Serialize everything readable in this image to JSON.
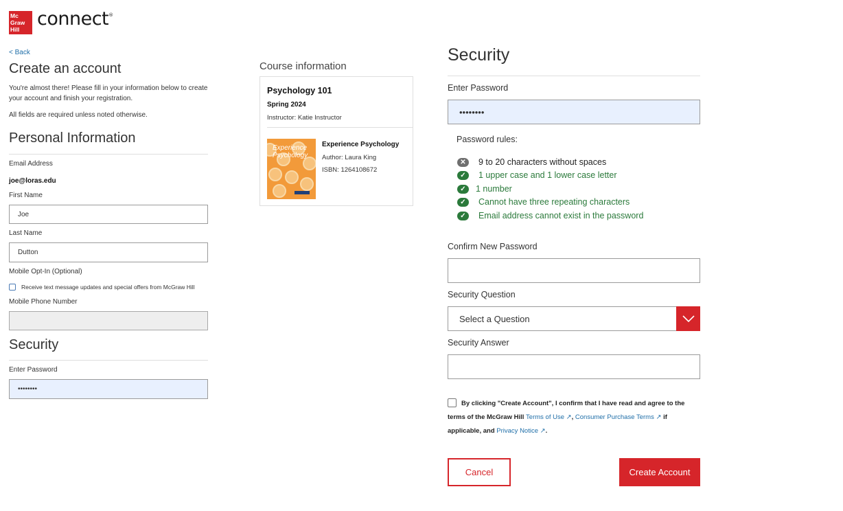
{
  "brand": {
    "logo_lines": [
      "Mc",
      "Graw",
      "Hill"
    ],
    "product": "connect",
    "accent": "#d6252a"
  },
  "nav": {
    "back": "< Back"
  },
  "page": {
    "title": "Create an account",
    "intro": "You're almost there! Please fill in your information below to create your account and finish your registration.",
    "required_note": "All fields are required unless noted otherwise."
  },
  "personal": {
    "heading": "Personal Information",
    "email_label": "Email Address",
    "email_value": "joe@loras.edu",
    "first_label": "First Name",
    "first_value": "Joe",
    "last_label": "Last Name",
    "last_value": "Dutton",
    "optin_label": "Mobile Opt-In (Optional)",
    "optin_text": "Receive text message updates and special offers from McGraw Hill",
    "phone_label": "Mobile Phone Number",
    "phone_value": ""
  },
  "security_left": {
    "heading": "Security",
    "password_label": "Enter Password",
    "password_value": "••••••••"
  },
  "course": {
    "heading": "Course information",
    "name": "Psychology 101",
    "term": "Spring 2024",
    "instructor": "Instructor: Katie Instructor",
    "book_cover_title": [
      "Experience",
      "Psychology"
    ],
    "book_title": "Experience Psychology",
    "author": "Author: Laura King",
    "isbn": "ISBN: 1264108672"
  },
  "security": {
    "heading": "Security",
    "password_label": "Enter Password",
    "password_value": "••••••••",
    "rules_heading": "Password rules:",
    "rules": [
      {
        "text": "9 to 20 characters without spaces",
        "status": "fail"
      },
      {
        "text": "1 upper case and 1 lower case letter",
        "status": "pass"
      },
      {
        "text": "1 number",
        "status": "pass"
      },
      {
        "text": "Cannot have three repeating characters",
        "status": "pass"
      },
      {
        "text": "Email address cannot exist in the password",
        "status": "pass"
      }
    ],
    "confirm_label": "Confirm New Password",
    "confirm_value": "",
    "question_label": "Security Question",
    "question_value": "Select a Question",
    "answer_label": "Security Answer",
    "answer_value": ""
  },
  "terms": {
    "prefix": "By clicking \"Create Account\", I confirm that I have read and agree to the terms of the McGraw Hill",
    "terms_link": "Terms of Use",
    "sep1": ",",
    "purchase_link": "Consumer Purchase Terms",
    "mid": "if applicable, and",
    "privacy_link": "Privacy Notice",
    "end": "."
  },
  "actions": {
    "cancel": "Cancel",
    "create": "Create Account"
  },
  "colors": {
    "pass": "#2b7a3b",
    "fail": "#6f6f6f",
    "link": "#1f6ea8",
    "pw_field": "#e8f0fe"
  }
}
